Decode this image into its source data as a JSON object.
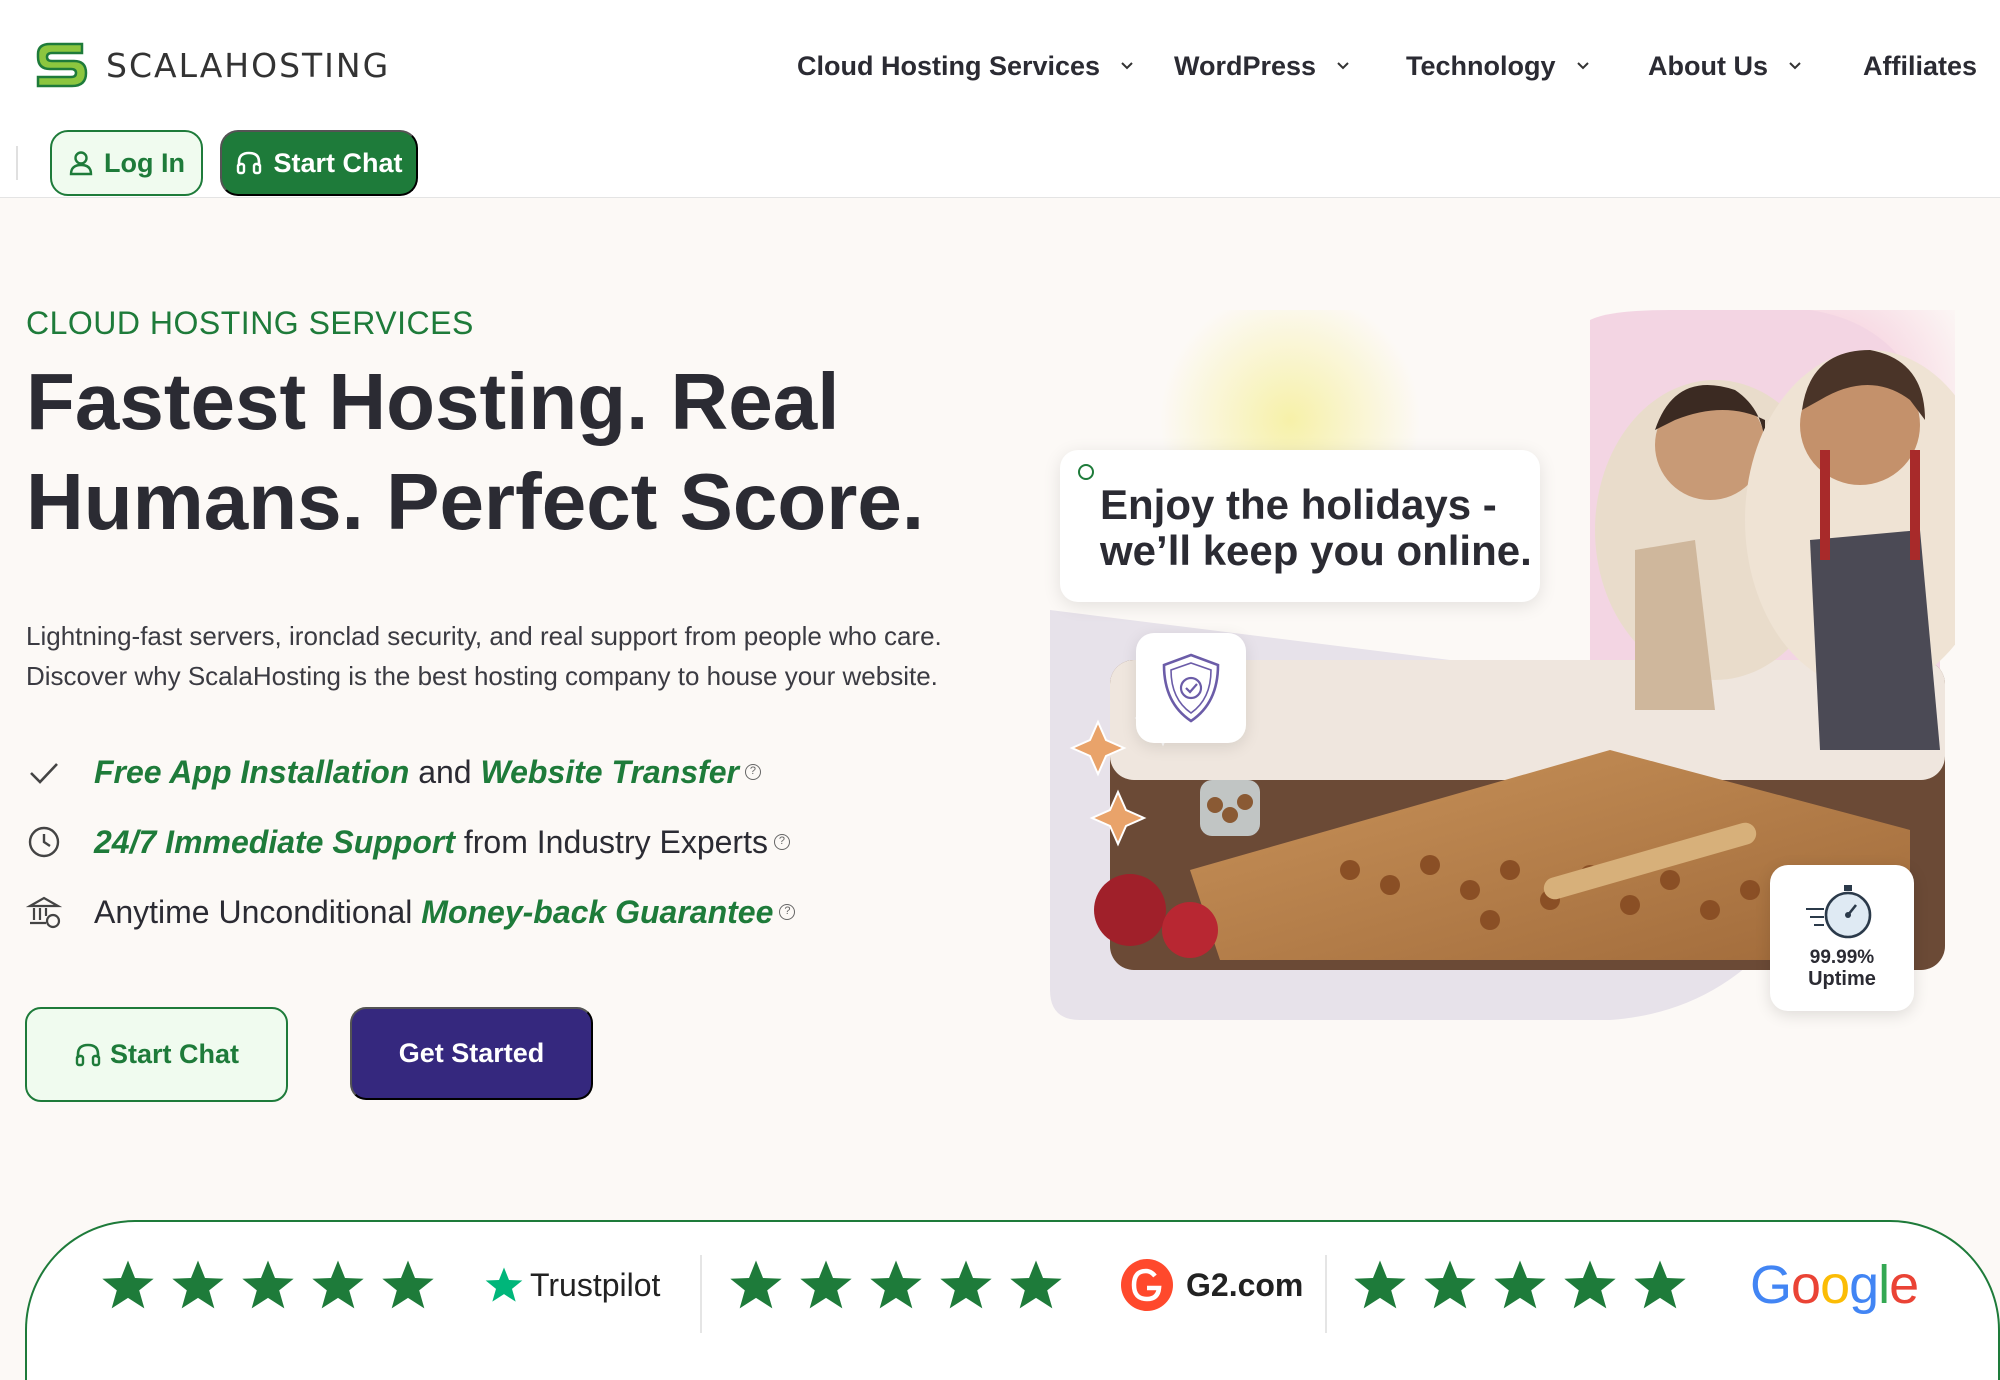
{
  "header": {
    "logo_text": "SCALAHOSTING",
    "nav": [
      {
        "label": "Cloud Hosting Services",
        "has_dropdown": true
      },
      {
        "label": "WordPress",
        "has_dropdown": true
      },
      {
        "label": "Technology",
        "has_dropdown": true
      },
      {
        "label": "About Us",
        "has_dropdown": true
      },
      {
        "label": "Affiliates",
        "has_dropdown": false
      }
    ],
    "login_label": "Log In",
    "start_chat_label": "Start Chat"
  },
  "hero": {
    "eyebrow": "CLOUD HOSTING SERVICES",
    "headline_line1": "Fastest Hosting. Real",
    "headline_line2": "Humans. Perfect Score.",
    "description_line1": "Lightning-fast servers, ironclad security, and real support from people who care.",
    "description_line2": "Discover why ScalaHosting is the best hosting company to house your website.",
    "features": [
      {
        "icon": "check-icon",
        "parts": [
          {
            "t": "Free App Installation",
            "em": true
          },
          {
            "t": " and ",
            "em": false
          },
          {
            "t": "Website Transfer",
            "em": true
          }
        ]
      },
      {
        "icon": "clock-icon",
        "parts": [
          {
            "t": "24/7 Immediate Support",
            "em": true
          },
          {
            "t": " from Industry Experts",
            "em": false
          }
        ]
      },
      {
        "icon": "bank-icon",
        "parts": [
          {
            "t": "Anytime Unconditional ",
            "em": false
          },
          {
            "t": "Money-back Guarantee",
            "em": true
          }
        ]
      }
    ],
    "help_glyph": "?",
    "cta_chat": "Start Chat",
    "cta_start": "Get Started",
    "bubble_line1": "Enjoy the holidays -",
    "bubble_line2": "we’ll keep you online.",
    "uptime_value": "99.99%",
    "uptime_label": "Uptime"
  },
  "ratings": [
    {
      "stars": 5,
      "brand": "Trustpilot",
      "logo": "trustpilot-star-icon"
    },
    {
      "stars": 5,
      "brand": "G2.com",
      "logo": "g2-logo-icon"
    },
    {
      "stars": 5,
      "brand": "Google",
      "logo": "google-wordmark"
    }
  ],
  "colors": {
    "brand_green": "#1e7b3a",
    "cta_purple": "#35287e",
    "star_green": "#1e7b3a",
    "page_bg": "#fcf9f6"
  }
}
